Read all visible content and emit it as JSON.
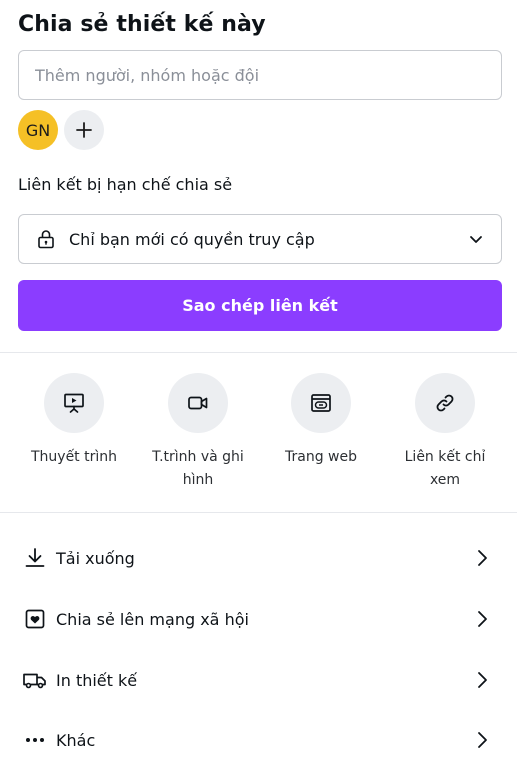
{
  "share": {
    "title": "Chia sẻ thiết kế này",
    "invite_placeholder": "Thêm người, nhóm hoặc đội",
    "avatar_initials": "GN",
    "add_person_icon": "plus-icon",
    "link_section_label": "Liên kết bị hạn chế chia sẻ",
    "access": {
      "icon": "lock-icon",
      "selected": "Chỉ bạn mới có quyền truy cập",
      "chevron": "chevron-down-icon"
    },
    "copy_link_label": "Sao chép liên kết"
  },
  "options": [
    {
      "label": "Thuyết trình",
      "icon": "presentation-icon"
    },
    {
      "label": "T.trình và ghi hình",
      "icon": "video-camera-icon"
    },
    {
      "label": "Trang web",
      "icon": "website-icon"
    },
    {
      "label": "Liên kết chỉ xem",
      "icon": "link-icon"
    }
  ],
  "actions": [
    {
      "label": "Tải xuống",
      "icon": "download-icon"
    },
    {
      "label": "Chia sẻ lên mạng xã hội",
      "icon": "heart-icon"
    },
    {
      "label": "In thiết kế",
      "icon": "truck-icon"
    },
    {
      "label": "Khác",
      "icon": "more-icon"
    }
  ],
  "colors": {
    "accent": "#8b3dff",
    "avatar_bg": "#f5c026",
    "icon_circle_bg": "#eceef1"
  }
}
